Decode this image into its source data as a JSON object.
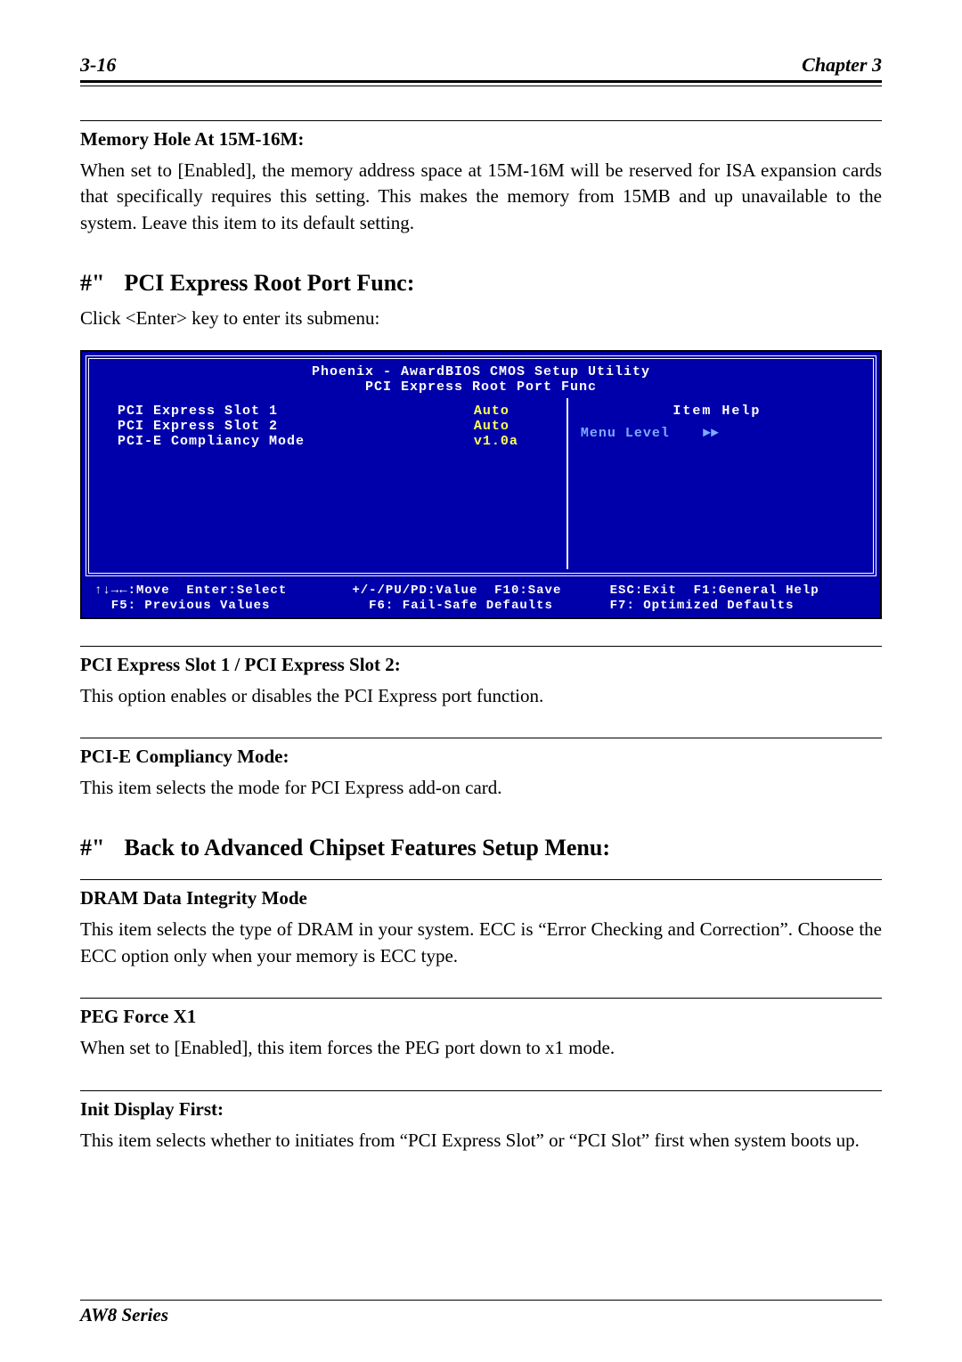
{
  "header": {
    "page_number": "3-16",
    "chapter": "Chapter 3"
  },
  "sections": {
    "memhole": {
      "title": "Memory Hole At 15M-16M:",
      "body": "When set to [Enabled], the memory address space at 15M-16M will be reserved for ISA expansion cards that specifically requires this setting. This makes the memory from 15MB and up unavailable to the system. Leave this item to its default setting."
    },
    "pcie_root": {
      "symbol": "#\"",
      "title": "PCI Express Root Port Func:",
      "intro": "Click <Enter> key to enter its submenu:"
    },
    "slot": {
      "title": "PCI Express Slot 1 / PCI Express Slot 2:",
      "body": "This option enables or disables the PCI Express port function."
    },
    "compliancy": {
      "title": "PCI-E Compliancy Mode:",
      "body": "This item selects the mode for PCI Express add-on card."
    },
    "back_menu": {
      "symbol": "#\"",
      "title": "Back to Advanced Chipset Features Setup Menu:"
    },
    "dram": {
      "title": "DRAM Data Integrity Mode",
      "body": "This item selects the type of DRAM in your system. ECC is “Error Checking and Correction”. Choose the ECC option only when your memory is ECC type."
    },
    "peg": {
      "title": "PEG Force X1",
      "body": "When set to [Enabled], this item forces the PEG port down to x1 mode."
    },
    "init": {
      "title": "Init Display First:",
      "body": "This item selects whether to initiates from “PCI Express Slot” or “PCI Slot” first when system boots up."
    }
  },
  "bios": {
    "title_line1": "Phoenix - AwardBIOS CMOS Setup Utility",
    "title_line2": "PCI Express Root Port Func",
    "items": [
      {
        "label": "PCI Express Slot 1",
        "value": "Auto"
      },
      {
        "label": "PCI Express Slot 2",
        "value": "Auto"
      },
      {
        "label": "PCI-E Compliancy Mode",
        "value": "v1.0a"
      }
    ],
    "help_title": "Item Help",
    "menu_level": "Menu Level",
    "menu_arrow": "►►",
    "footer": {
      "col1": "↑↓→←:Move  Enter:Select\n  F5: Previous Values",
      "col2": "+/-/PU/PD:Value  F10:Save\n  F6: Fail-Safe Defaults",
      "col3": "ESC:Exit  F1:General Help\nF7: Optimized Defaults"
    }
  },
  "footer": {
    "series": "AW8 Series"
  }
}
